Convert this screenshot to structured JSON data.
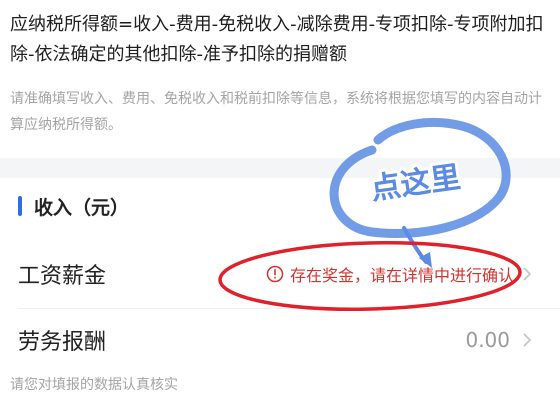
{
  "formula_text": "应纳税所得额=收入-费用-免税收入-减除费用-专项扣除-专项附加扣除-依法确定的其他扣除-准予扣除的捐赠额",
  "hint_text": "请准确填写收入、费用、免税收入和税前扣除等信息，系统将根据您填写的内容自动计算应纳税所得额。",
  "section": {
    "title": "收入（元）"
  },
  "rows": [
    {
      "label": "工资薪金",
      "alert_icon": "warning-circle-icon",
      "alert_text": "存在奖金，请在详情中进行确认",
      "chevron_icon": "chevron-right-icon"
    },
    {
      "label": "劳务报酬",
      "value": "0.00",
      "chevron_icon": "chevron-right-icon"
    }
  ],
  "footer_note": "请您对填报的数据认真核实",
  "annotation": {
    "label": "点这里"
  },
  "colors": {
    "accent_blue": "#2f6fe0",
    "alert_red": "#d8312d",
    "annotation_red": "#e0202a",
    "annotation_blue": "#5b8be3",
    "chevron_gray": "#c4c4c4"
  }
}
